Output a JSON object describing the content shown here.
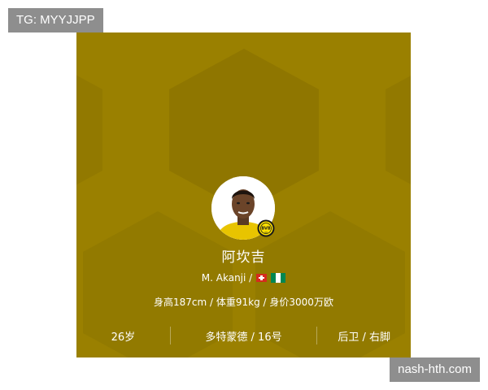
{
  "watermarks": {
    "top_left": "TG: MYYJJPP",
    "bottom_right": "nash-hth.com"
  },
  "card": {
    "background_color": "#9a8000",
    "player_name_cn": "阿坎吉",
    "player_name_en": "M. Akanji /",
    "nationality_flags": [
      "switzerland-flag-icon",
      "nigeria-flag-icon"
    ],
    "club_badge_icon": "bvb-club-badge-icon",
    "stats_line": "身高187cm / 体重91kg / 身价3000万欧",
    "age": "26岁",
    "club_number": "多特蒙德 / 16号",
    "position_foot": "后卫 / 右脚"
  }
}
